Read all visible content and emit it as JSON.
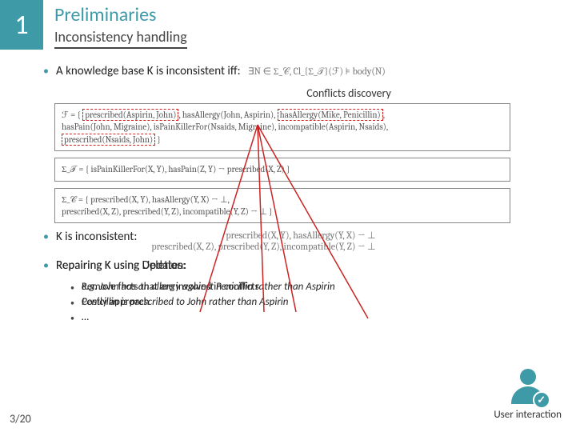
{
  "slide": {
    "number": "1",
    "title": "Preliminaries",
    "subtitle": "Inconsistency handling",
    "page_counter": "3/20"
  },
  "bullets": {
    "b1_prefix": "A knowledge base K is inconsistent iff:",
    "b1_formula": "∃N ∈ Σ_𝒞, Cl_{Σ_𝒯}(ℱ) ⊧ body(N)",
    "callout": "Conflicts discovery",
    "b2": "K is inconsistent:",
    "b2_formula1": "prescribed(X, Y), hasAllergy(Y, X) → ⊥",
    "b2_formula2": "prescribed(X, Z), prescribed(Y, Z), incompatible(Y, Z) → ⊥",
    "b3_label_a": "Repairing K using Deletion:",
    "b3_label_b": "Repairing K using Updates:",
    "sub1a": "Remove facts that are involved in conflicts",
    "sub1b": "e.g. John has an allergy against Penicillin rather than Aspirin",
    "sub2a": "Costly approach",
    "sub2b": "Penicillin is prescribed to John rather than Aspirin",
    "sub3": "…"
  },
  "boxes": {
    "f_line1": "ℱ = { prescribed(Aspirin, John), hasAllergy(John, Aspirin), hasAllergy(Mike, Penicillin),",
    "f_line2": "hasPain(John, Migraine), isPainKillerFor(Nsaids, Migraine), incompatible(Aspirin, Nsaids),",
    "f_line3": "prescribed(Nsaids, John) }",
    "sigma_t": "Σ_𝒯 = { isPainKillerFor(X, Y), hasPain(Z, Y) → prescribed(X, Z) }",
    "sigma_c1": "Σ_𝒞 = { prescribed(X, Y), hasAllergy(Y, X) → ⊥,",
    "sigma_c2": "prescribed(X, Z), prescribed(Y, Z), incompatible(Y, Z) → ⊥ }"
  },
  "user_interaction_label": "User interaction"
}
